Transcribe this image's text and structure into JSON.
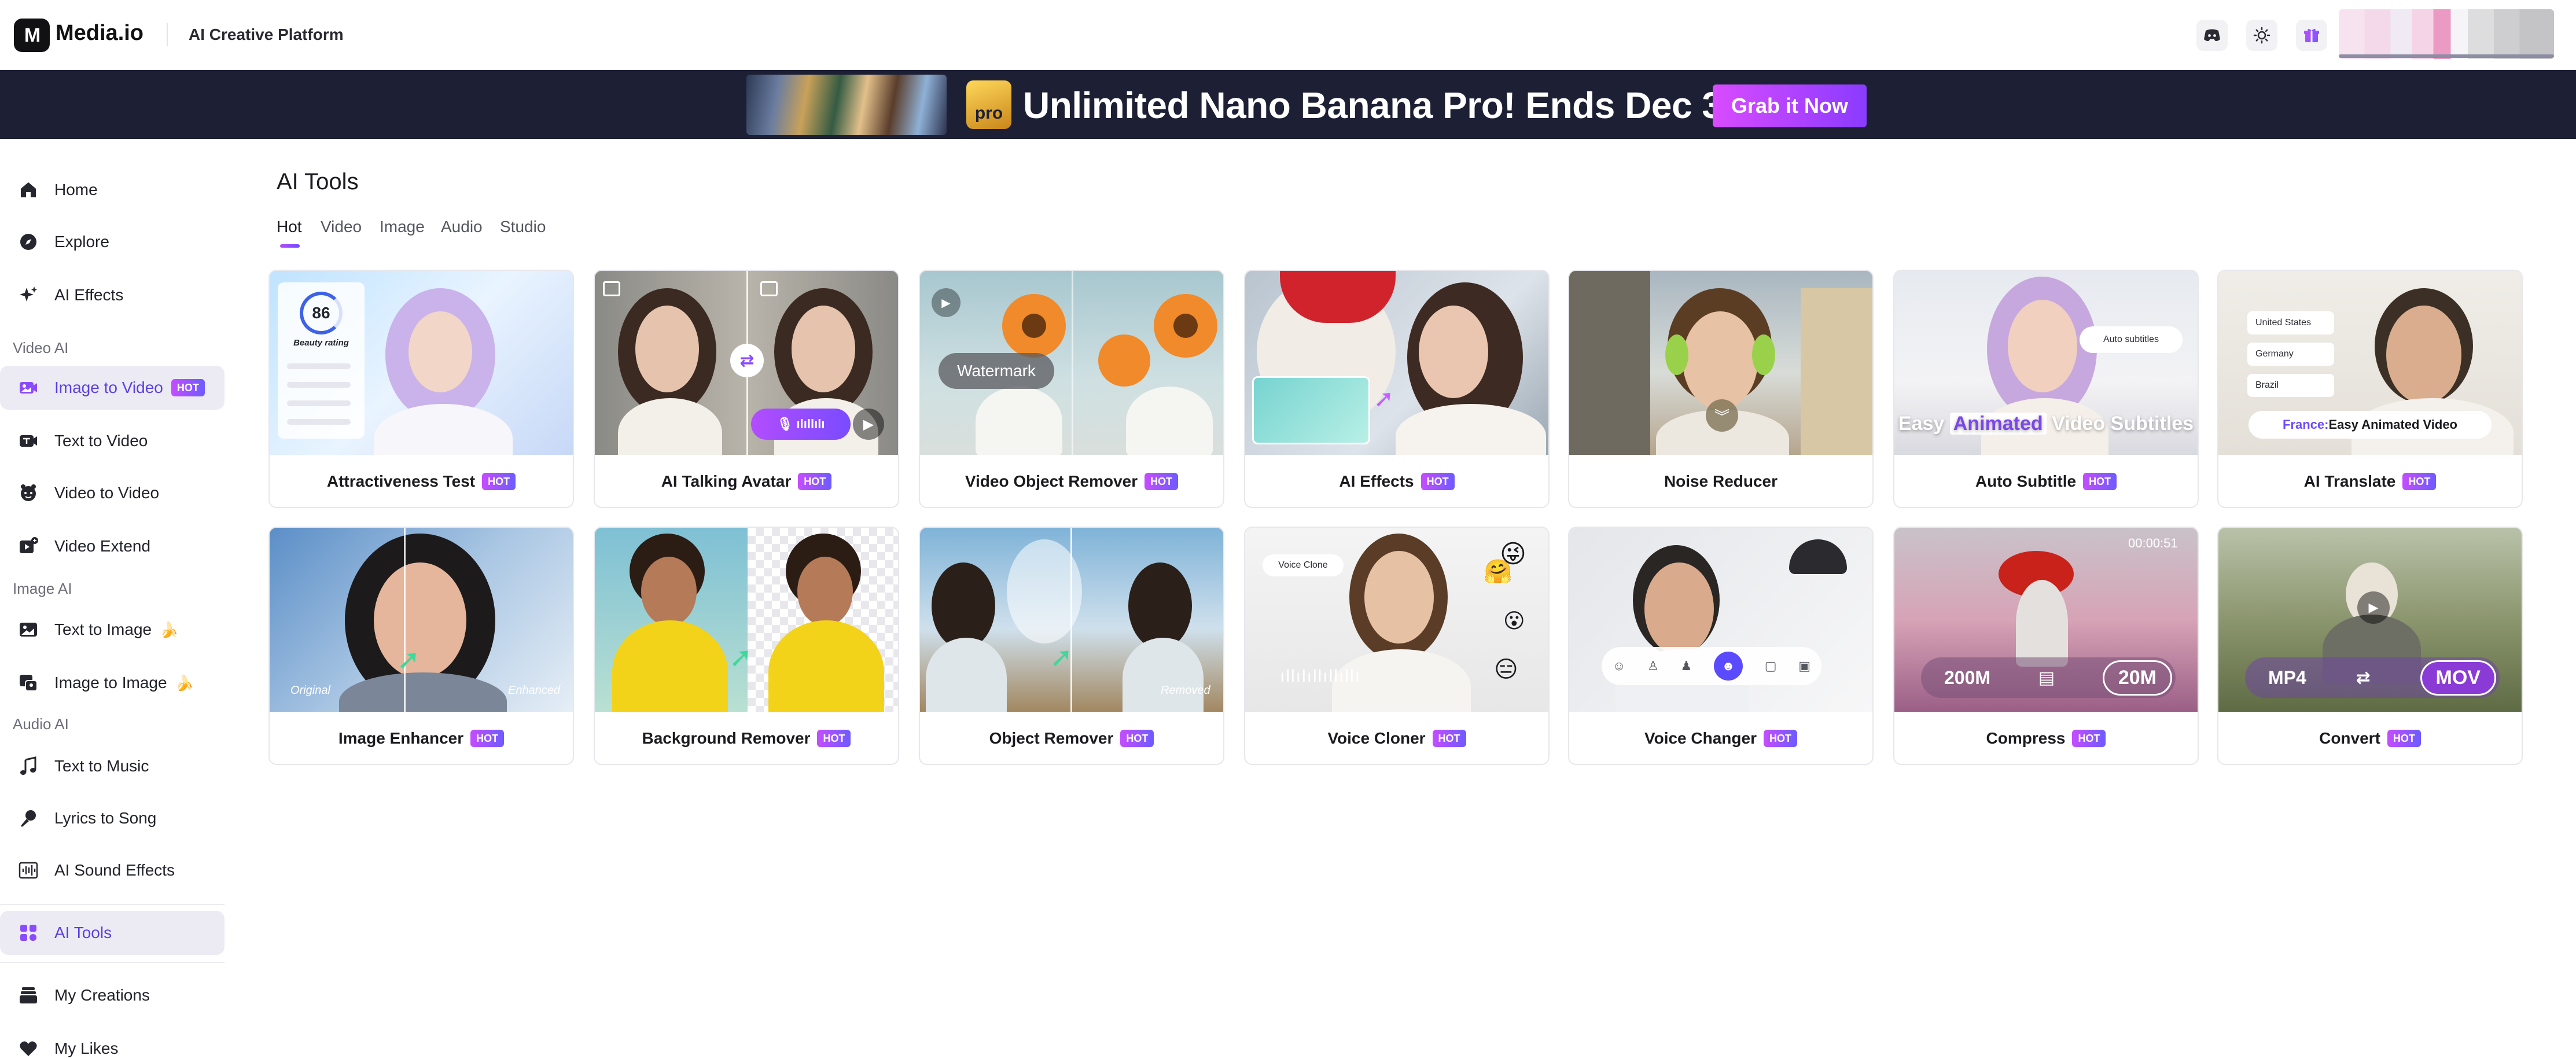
{
  "app": {
    "logo_mark": "M",
    "name": "Media.io",
    "platform_label": "AI Creative Platform"
  },
  "top_icons": [
    "discord-icon",
    "sun-icon",
    "gift-icon"
  ],
  "banner": {
    "badge": "pro",
    "text": "Unlimited Nano Banana Pro! Ends Dec 31.",
    "button": "Grab it Now"
  },
  "sidebar": {
    "items": {
      "home": "Home",
      "explore": "Explore",
      "ai_effects": "AI Effects",
      "image_to_video": "Image to Video",
      "text_to_video": "Text to Video",
      "video_to_video": "Video to Video",
      "video_extend": "Video Extend",
      "text_to_image": "Text to Image",
      "image_to_image": "Image to Image",
      "text_to_music": "Text to Music",
      "lyrics_to_song": "Lyrics to Song",
      "ai_sound_effects": "AI Sound Effects",
      "ai_tools": "AI Tools",
      "my_creations": "My Creations",
      "my_likes": "My Likes"
    },
    "sections": {
      "video_ai": "Video AI",
      "image_ai": "Image AI",
      "audio_ai": "Audio AI"
    },
    "badge_hot": "HOT",
    "active": "AI Tools"
  },
  "main": {
    "title": "AI Tools",
    "tabs": [
      "Hot",
      "Video",
      "Image",
      "Audio",
      "Studio"
    ],
    "active_tab": "Hot",
    "hot_label": "HOT",
    "cards": [
      {
        "title": "Attractiveness Test",
        "hot": true,
        "score": "86",
        "score_caption": "Beauty rating"
      },
      {
        "title": "AI Talking Avatar",
        "hot": true
      },
      {
        "title": "Video Object Remover",
        "hot": true,
        "overlay": "Watermark"
      },
      {
        "title": "AI Effects",
        "hot": true
      },
      {
        "title": "Noise Reducer",
        "hot": false
      },
      {
        "title": "Auto Subtitle",
        "hot": true,
        "overlay_pre": "Easy ",
        "overlay_hl": "Animated",
        "overlay_post": " Video Subtitles",
        "chip": "Auto subtitles"
      },
      {
        "title": "AI Translate",
        "hot": true,
        "langs": [
          "United States",
          "Germany",
          "Brazil"
        ],
        "overlay_country": "France:",
        "overlay_text": " Easy Animated Video"
      },
      {
        "title": "Image Enhancer",
        "hot": true,
        "left_caption": "Original",
        "right_caption": "Enhanced"
      },
      {
        "title": "Background Remover",
        "hot": true
      },
      {
        "title": "Object Remover",
        "hot": true,
        "right_caption": "Removed"
      },
      {
        "title": "Voice Cloner",
        "hot": true,
        "chip": "Voice Clone"
      },
      {
        "title": "Voice Changer",
        "hot": true
      },
      {
        "title": "Compress",
        "hot": true,
        "timecode": "00:00:51",
        "from": "200M",
        "to": "20M"
      },
      {
        "title": "Convert",
        "hot": true,
        "from": "MP4",
        "to": "MOV"
      }
    ]
  },
  "colors": {
    "accent": "#5b3fe6",
    "hot_start": "#c54dff",
    "hot_end": "#6d5bff",
    "banner_bg": "#1d2035"
  }
}
